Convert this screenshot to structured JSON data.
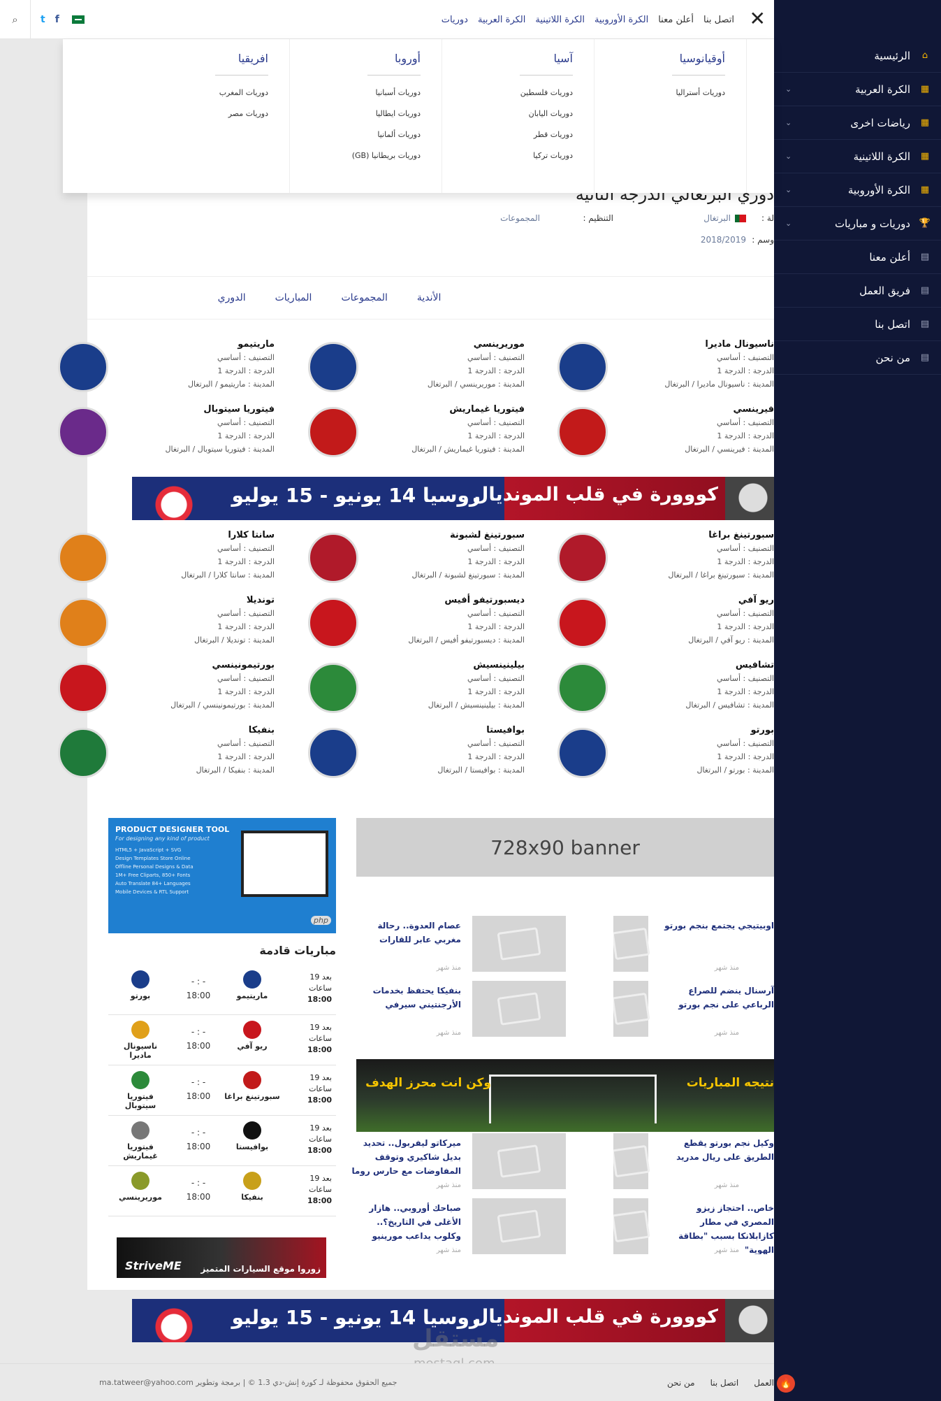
{
  "sidebar": {
    "items": [
      {
        "label": "الرئيسية",
        "icon": "home-icon",
        "chev": false
      },
      {
        "label": "الكرة العربية",
        "icon": "grid-icon",
        "chev": true
      },
      {
        "label": "رياضات اخرى",
        "icon": "grid-icon",
        "chev": true
      },
      {
        "label": "الكرة اللاتينية",
        "icon": "grid-icon",
        "chev": true
      },
      {
        "label": "الكرة الأوروبية",
        "icon": "grid-icon",
        "chev": true
      },
      {
        "label": "دوريات و مباريات",
        "icon": "trophy-icon",
        "chev": true
      },
      {
        "label": "أعلن معنا",
        "icon": "page-icon",
        "chev": false
      },
      {
        "label": "فريق العمل",
        "icon": "page-icon",
        "chev": false
      },
      {
        "label": "اتصل بنا",
        "icon": "page-icon",
        "chev": false
      },
      {
        "label": "من نحن",
        "icon": "page-icon",
        "chev": false
      }
    ]
  },
  "topbar": {
    "nav": [
      "دوريات",
      "الكرة العربية",
      "الكرة اللاتينية",
      "الكرة الأوروبية",
      "أعلن معنا",
      "اتصل بنا"
    ]
  },
  "megamenu": {
    "columns": [
      {
        "title": "أوقيانوسيا",
        "links": [
          "دوريات أستراليا"
        ]
      },
      {
        "title": "آسيا",
        "links": [
          "دوريات فلسطين",
          "دوريات اليابان",
          "دوريات قطر",
          "دوريات تركيا"
        ]
      },
      {
        "title": "أوروبا",
        "links": [
          "دوريات أسبانيا",
          "دوريات ايطاليا",
          "دوريات ألمانيا",
          "دوريات بريطانيا (GB)"
        ]
      },
      {
        "title": "افريقيا",
        "links": [
          "دوريات المغرب",
          "دوريات مصر"
        ]
      }
    ]
  },
  "league": {
    "title": "دوري البرتغالي الدرجة الثانية",
    "country_label": "لة :",
    "country_value": "البرتغال",
    "season_label": "وسم :",
    "season_value": "2018/2019",
    "org_label": "التنظيم :",
    "org_value": "المجموعات"
  },
  "tabs": [
    "الدوري",
    "المباريات",
    "المجموعات",
    "الأندية"
  ],
  "club_labels": {
    "class": "التصنيف : أساسي",
    "level": "الدرجة : الدرجة 1",
    "city_prefix": "المدينة : "
  },
  "clubs": [
    {
      "name": "ناسيونال ماديرا",
      "city": "ناسيونال ماديرا / البرتغال",
      "color": "#1a3d8a"
    },
    {
      "name": "موريرينسي",
      "city": "موريرينسي / البرتغال",
      "color": "#1a3d8a"
    },
    {
      "name": "ماريتيمو",
      "city": "ماريتيمو / البرتغال",
      "color": "#1a3d8a"
    },
    {
      "name": "فيرينسي",
      "city": "فيرينسي / البرتغال",
      "color": "#c21a1a"
    },
    {
      "name": "فيتوريا غيماريش",
      "city": "فيتوريا غيماريش / البرتغال",
      "color": "#c21a1a"
    },
    {
      "name": "فيتوريا سيتوبال",
      "city": "فيتوريا سيتوبال / البرتغال",
      "color": "#6a2a8a"
    },
    {
      "name": "سبورتينغ براغا",
      "city": "سبورتينغ براغا / البرتغال",
      "color": "#b01a2a"
    },
    {
      "name": "سبورتينغ لشبونة",
      "city": "سبورتينغ لشبونة / البرتغال",
      "color": "#b01a2a"
    },
    {
      "name": "سانتا كلارا",
      "city": "سانتا كلارا / البرتغال",
      "color": "#e0801a"
    },
    {
      "name": "ريو آفي",
      "city": "ريو آفي / البرتغال",
      "color": "#c8161d"
    },
    {
      "name": "ديسبورتيفو أفيس",
      "city": "ديسبورتيفو أفيس / البرتغال",
      "color": "#c8161d"
    },
    {
      "name": "تونديلا",
      "city": "تونديلا / البرتغال",
      "color": "#e0801a"
    },
    {
      "name": "تشافيس",
      "city": "تشافيس / البرتغال",
      "color": "#2c8a3a"
    },
    {
      "name": "بيلينينسيش",
      "city": "بيلينينسيش / البرتغال",
      "color": "#2c8a3a"
    },
    {
      "name": "بورتيمونينسي",
      "city": "بورتيمونينسي / البرتغال",
      "color": "#c8161d"
    },
    {
      "name": "بورتو",
      "city": "بورتو / البرتغال",
      "color": "#1a3d8a"
    },
    {
      "name": "بوافيستا",
      "city": "بوافيستا / البرتغال",
      "color": "#1a3d8a"
    },
    {
      "name": "بنفيكا",
      "city": "بنفيكا / البرتغال",
      "color": "#1f7a3a"
    }
  ],
  "wc_banner": {
    "right": "كووورة في قلب المونديال",
    "left": "روسيا 14 يونيو - 15 يوليو"
  },
  "ads": {
    "product_title": "PRODUCT DESIGNER TOOL",
    "product_sub": "For designing any kind of product",
    "product_list": [
      "HTML5 + JavaScript + SVG",
      "Design Templates Store Online",
      "Offline Personal Designs & Data",
      "1M+ Free Cliparts, 850+ Fonts",
      "Auto Translate 84+ Languages",
      "Mobile Devices & RTL Support"
    ],
    "product_tag": "php",
    "banner728": "728x90 banner",
    "strive_brand": "StriveME",
    "strive_text": "زوروا موقع السيارات المتميز"
  },
  "upcoming": {
    "title": "مباريات قادمة",
    "when": [
      "بعد 19",
      "ساعات",
      "18:00"
    ],
    "score": "- : -",
    "time": "18:00",
    "matches": [
      {
        "home": "ماريتيمو",
        "away": "بورتو",
        "hc": "#1a3d8a",
        "ac": "#1a3d8a"
      },
      {
        "home": "ريو آفي",
        "away": "ناسيونال ماديرا",
        "hc": "#c8161d",
        "ac": "#e0a01a"
      },
      {
        "home": "سبورتينغ براغا",
        "away": "فيتوريا سيتوبال",
        "hc": "#c21a1a",
        "ac": "#2c8a3a"
      },
      {
        "home": "بوافيستا",
        "away": "فيتوريا غيماريش",
        "hc": "#111111",
        "ac": "#777777"
      },
      {
        "home": "بنفيكا",
        "away": "موريرينسي",
        "hc": "#c8a01a",
        "ac": "#8a9a2a"
      }
    ]
  },
  "news": [
    {
      "title": "اوبيتيجي يجتمع بنجم بورتو",
      "time": "منذ شهر"
    },
    {
      "title": "عصام العدوة.. رحالة مغربي عابر للقارات",
      "time": "منذ شهر"
    },
    {
      "title": "آرسنال ينضم للصراع الرباعي على نجم بورتو",
      "time": "منذ شهر"
    },
    {
      "title": "بنفيكا يحتفظ بخدمات الأرجنتيني سيرفي",
      "time": "منذ شهر"
    },
    {
      "title": "وكيل نجم بورتو يقطع الطريق على ريال مدريد",
      "time": "منذ شهر"
    },
    {
      "title": "ميركاتو ليفربول.. تحديد بديل شاكيري وتوقف المفاوضات مع حارس روما",
      "time": "منذ شهر"
    },
    {
      "title": "خاص.. احتجاز زيزو المصري في مطار كازابلانكا بسبب \"بطاقة الهوية\"",
      "time": "منذ شهر"
    },
    {
      "title": "صباحك أوروبي.. هازار الأغلى في التاريخ؟.. وكلوب يداعب مورينيو",
      "time": "منذ شهر"
    }
  ],
  "stadium": {
    "right": "نتيجه المباريات",
    "left": "وكن انت محرز الهدف"
  },
  "footer": {
    "links": [
      "العمل",
      "اتصل بنا",
      "من نحن"
    ],
    "copyright": "جميع الحقوق محفوظة لـ كورة إنش-دي 1.3 © | برمجة وتطوير ma.tatweer@yahoo.com"
  },
  "watermark": {
    "main": "مستقل",
    "sub": "mostaql.com"
  },
  "icons": {
    "close": "✕",
    "search": "⌕",
    "twitter": "t",
    "facebook": "f"
  }
}
